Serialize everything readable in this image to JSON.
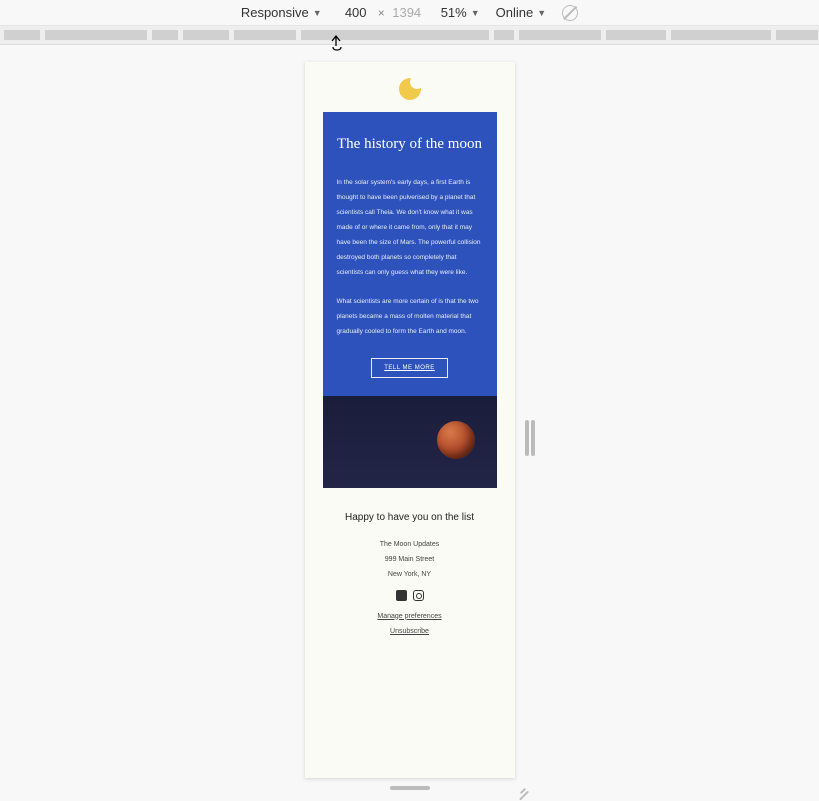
{
  "toolbar": {
    "device": "Responsive",
    "width": "400",
    "height": "1394",
    "zoom": "51%",
    "throttle": "Online"
  },
  "email": {
    "title": "The history of the moon",
    "p1": "In the solar system's early days, a first Earth is thought to have been pulverised by a planet that scientists call Theia. We don't know what it was made of or where it came from, only that it may have been the size of Mars. The powerful collision destroyed both planets so completely that scientists can only guess what they were like.",
    "p2": "What scientists are more certain of is that the two planets became a mass of molten material that gradually cooled to form the Earth and moon.",
    "cta": "TELL ME MORE"
  },
  "footer": {
    "heading": "Happy to have you on the list",
    "org": "The Moon Updates",
    "addr": "999 Main Street",
    "city": "New York, NY",
    "manage": "Manage preferences",
    "unsub": "Unsubscribe"
  }
}
